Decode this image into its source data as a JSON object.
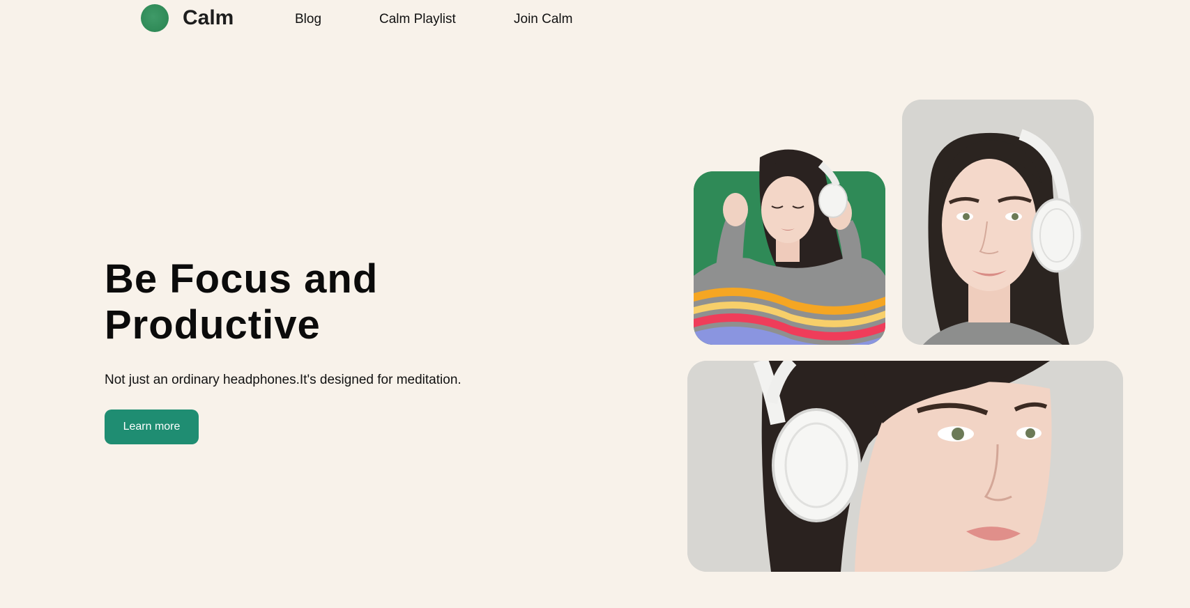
{
  "brand": {
    "name": "Calm",
    "logo_color": "#2f8a57"
  },
  "nav": {
    "links": [
      "Blog",
      "Calm Playlist",
      "Join Calm"
    ]
  },
  "hero": {
    "title_line1": "Be Focus and",
    "title_line2": "Productive",
    "subtitle": "Not just an ordinary headphones.It's designed for meditation.",
    "cta_label": "Learn more",
    "cta_color": "#1f8d72"
  },
  "images": [
    {
      "name": "woman-gray-sweater-headphones",
      "background": "#2f8a57"
    },
    {
      "name": "woman-portrait-headphones",
      "background": "#d6d5d1"
    },
    {
      "name": "woman-closeup-headphones",
      "background": "#d7d6d2"
    }
  ],
  "colors": {
    "page_background": "#f8f2ea",
    "text": "#111111"
  }
}
